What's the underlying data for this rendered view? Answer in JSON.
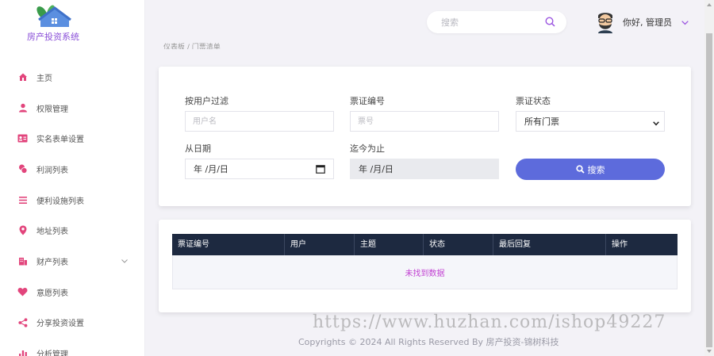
{
  "app": {
    "logo_text": "房产投资系统"
  },
  "sidebar": {
    "items": [
      {
        "label": "主页",
        "icon": "home-icon"
      },
      {
        "label": "权限管理",
        "icon": "user-icon"
      },
      {
        "label": "实名表单设置",
        "icon": "id-card-icon"
      },
      {
        "label": "利润列表",
        "icon": "coins-icon"
      },
      {
        "label": "便利设施列表",
        "icon": "list-icon"
      },
      {
        "label": "地址列表",
        "icon": "map-marker-icon"
      },
      {
        "label": "财产列表",
        "icon": "building-icon",
        "has_submenu": true
      },
      {
        "label": "意愿列表",
        "icon": "heart-icon"
      },
      {
        "label": "分享投资设置",
        "icon": "share-icon"
      },
      {
        "label": "分析管理",
        "icon": "bar-chart-icon"
      }
    ]
  },
  "topbar": {
    "search_placeholder": "搜索",
    "greeting": "你好, 管理员"
  },
  "breadcrumb": "仪表板 / 门票清单",
  "filters": {
    "user_label": "按用户过滤",
    "user_placeholder": "用户名",
    "ticket_label": "票证编号",
    "ticket_placeholder": "票号",
    "status_label": "票证状态",
    "status_value": "所有门票",
    "from_label": "从日期",
    "from_value": "年 /月/日",
    "to_label": "迄今为止",
    "to_value": "年 /月/日",
    "search_button": "搜索"
  },
  "table": {
    "columns": [
      "票证编号",
      "用户",
      "主题",
      "状态",
      "最后回复",
      "操作"
    ],
    "empty_text": "未找到数据"
  },
  "watermark": "https://www.huzhan.com/ishop49227",
  "footer": "Copyrights © 2024 All Rights Reserved By 房产投资-锦树科技",
  "colors": {
    "accent": "#5d6bdc",
    "sidebar_icon": "#e2457c",
    "table_header": "#1d2940",
    "empty_text": "#c243d3"
  }
}
